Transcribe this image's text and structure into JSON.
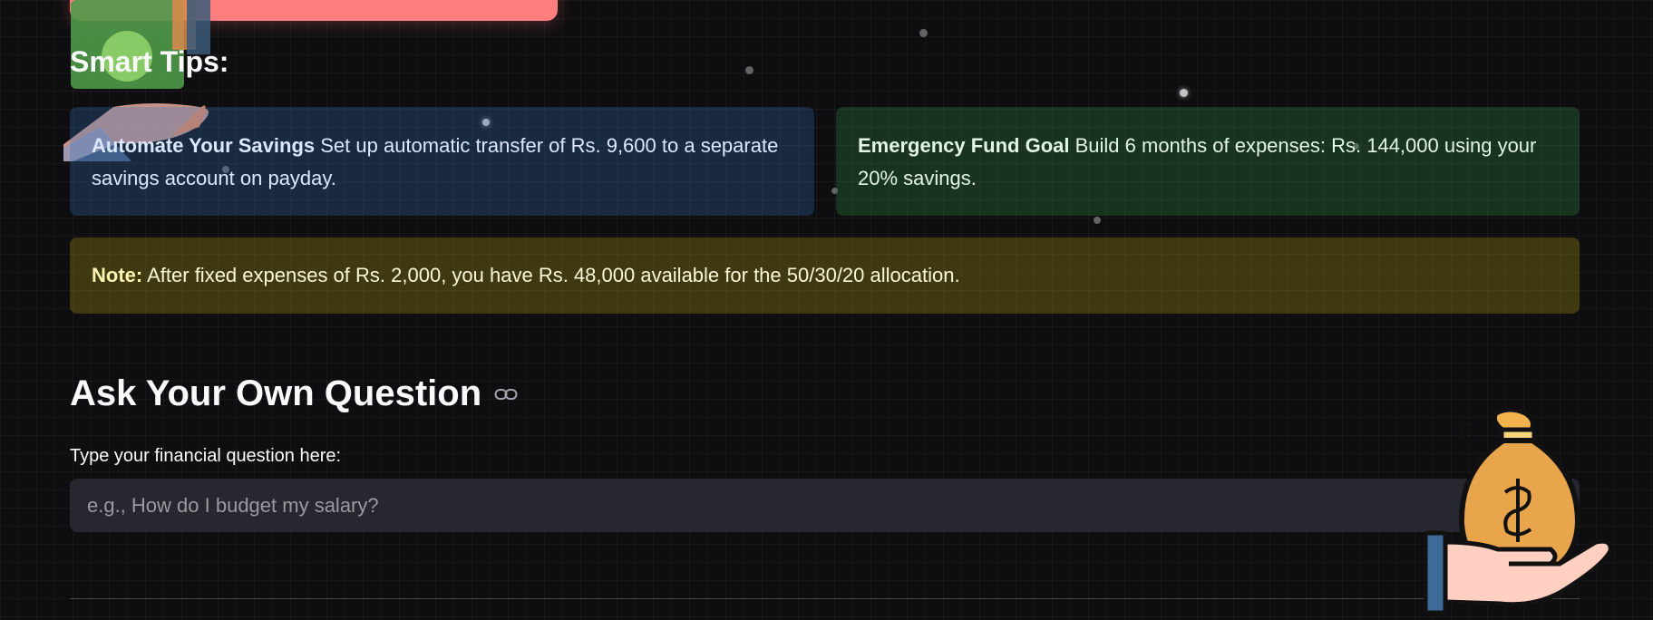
{
  "tips_section": {
    "heading": "Smart Tips:",
    "tips": [
      {
        "title": "Automate Your Savings",
        "body": " Set up automatic transfer of Rs. 9,600 to a separate savings account on payday."
      },
      {
        "title": "Emergency Fund Goal",
        "body": " Build 6 months of expenses: Rs. 144,000 using your 20% savings."
      }
    ],
    "note": {
      "label": "Note:",
      "body": " After fixed expenses of Rs. 2,000, you have Rs. 48,000 available for the 50/30/20 allocation."
    }
  },
  "ask_section": {
    "heading": "Ask Your Own Question",
    "input_label": "Type your financial question here:",
    "input_placeholder": "e.g., How do I budget my salary?",
    "input_value": ""
  },
  "icons": {
    "heading_anchor": "link-icon",
    "decor_left": "money-hand-icon",
    "decor_right": "money-bag-hand-icon"
  },
  "colors": {
    "background": "#0e0e10",
    "banner": "#ff7f7f",
    "tip_blue": "#1e3552",
    "tip_green": "#1f3d26",
    "note_yellow": "#3f3812",
    "input_bg": "#262730"
  }
}
